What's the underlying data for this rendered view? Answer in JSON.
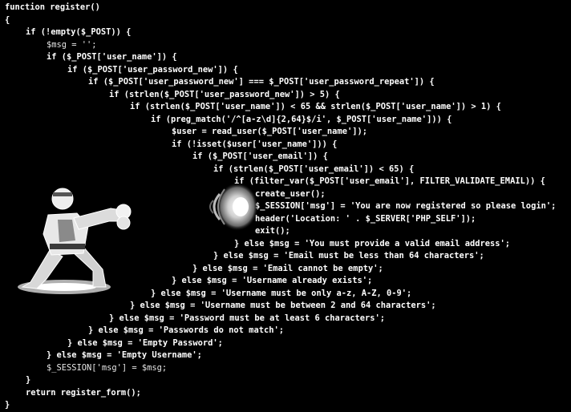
{
  "code": {
    "lines": [
      {
        "indent": 0,
        "text": "function register()",
        "bold": true
      },
      {
        "indent": 0,
        "text": "{",
        "bold": true
      },
      {
        "indent": 1,
        "text": "if (!empty($_POST)) {",
        "bold": true
      },
      {
        "indent": 2,
        "text": "$msg = '';",
        "bold": false
      },
      {
        "indent": 2,
        "text": "if ($_POST['user_name']) {",
        "bold": true
      },
      {
        "indent": 3,
        "text": "if ($_POST['user_password_new']) {",
        "bold": true
      },
      {
        "indent": 4,
        "text": "if ($_POST['user_password_new'] === $_POST['user_password_repeat']) {",
        "bold": true
      },
      {
        "indent": 5,
        "text": "if (strlen($_POST['user_password_new']) > 5) {",
        "bold": true
      },
      {
        "indent": 6,
        "text": "if (strlen($_POST['user_name']) < 65 && strlen($_POST['user_name']) > 1) {",
        "bold": true
      },
      {
        "indent": 7,
        "text": "if (preg_match('/^[a-z\\d]{2,64}$/i', $_POST['user_name'])) {",
        "bold": true
      },
      {
        "indent": 8,
        "text": "$user = read_user($_POST['user_name']);",
        "bold": true
      },
      {
        "indent": 8,
        "text": "if (!isset($user['user_name'])) {",
        "bold": true
      },
      {
        "indent": 9,
        "text": "if ($_POST['user_email']) {",
        "bold": true
      },
      {
        "indent": 10,
        "text": "if (strlen($_POST['user_email']) < 65) {",
        "bold": true
      },
      {
        "indent": 11,
        "text": "if (filter_var($_POST['user_email'], FILTER_VALIDATE_EMAIL)) {",
        "bold": true
      },
      {
        "indent": 12,
        "text": "create_user();",
        "bold": true
      },
      {
        "indent": 12,
        "text": "$_SESSION['msg'] = 'You are now registered so please login';",
        "bold": true
      },
      {
        "indent": 12,
        "text": "header('Location: ' . $_SERVER['PHP_SELF']);",
        "bold": true
      },
      {
        "indent": 12,
        "text": "exit();",
        "bold": true
      },
      {
        "indent": 11,
        "text": "} else $msg = 'You must provide a valid email address';",
        "bold": true
      },
      {
        "indent": 10,
        "text": "} else $msg = 'Email must be less than 64 characters';",
        "bold": true
      },
      {
        "indent": 9,
        "text": "} else $msg = 'Email cannot be empty';",
        "bold": true
      },
      {
        "indent": 8,
        "text": "} else $msg = 'Username already exists';",
        "bold": true
      },
      {
        "indent": 7,
        "text": "} else $msg = 'Username must be only a-z, A-Z, 0-9';",
        "bold": true
      },
      {
        "indent": 6,
        "text": "} else $msg = 'Username must be between 2 and 64 characters';",
        "bold": true
      },
      {
        "indent": 5,
        "text": "} else $msg = 'Password must be at least 6 characters';",
        "bold": true
      },
      {
        "indent": 4,
        "text": "} else $msg = 'Passwords do not match';",
        "bold": true
      },
      {
        "indent": 3,
        "text": "} else $msg = 'Empty Password';",
        "bold": true
      },
      {
        "indent": 2,
        "text": "} else $msg = 'Empty Username';",
        "bold": true
      },
      {
        "indent": 2,
        "text": "$_SESSION['msg'] = $msg;",
        "bold": false
      },
      {
        "indent": 1,
        "text": "}",
        "bold": true
      },
      {
        "indent": 1,
        "text": "return register_form();",
        "bold": true
      },
      {
        "indent": 0,
        "text": "}",
        "bold": true
      }
    ]
  },
  "illustration": {
    "fighter": "fighter-throwing-fireball-icon",
    "projectile": "fireball-icon"
  },
  "colors": {
    "background": "#000000",
    "code_text": "#e6e6e6"
  }
}
